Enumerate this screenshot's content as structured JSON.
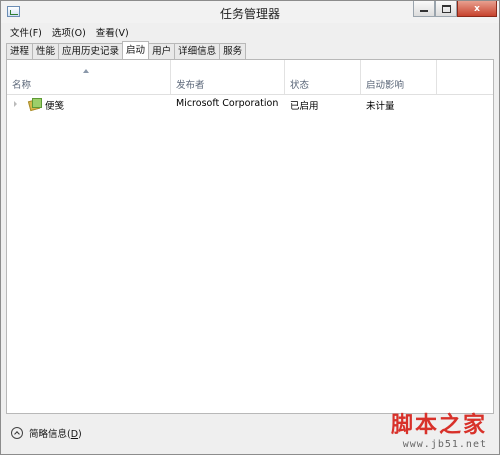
{
  "window": {
    "title": "任务管理器",
    "controls": {
      "close_label": "x"
    }
  },
  "menubar": {
    "items": [
      "文件(F)",
      "选项(O)",
      "查看(V)"
    ]
  },
  "tabs": [
    "进程",
    "性能",
    "应用历史记录",
    "启动",
    "用户",
    "详细信息",
    "服务"
  ],
  "active_tab": "启动",
  "table": {
    "columns": [
      "名称",
      "发布者",
      "状态",
      "启动影响"
    ],
    "rows": [
      {
        "name": "便笺",
        "publisher": "Microsoft Corporation",
        "status": "已启用",
        "impact": "未计量"
      }
    ]
  },
  "footer": {
    "toggle_label": "简略信息(",
    "toggle_key": "D",
    "toggle_end": ")"
  },
  "watermark": {
    "main": "脚本之家",
    "sub": "www.jb51.net"
  },
  "colors": {
    "header_text": "#5a6678",
    "watermark_red": "#d8312a"
  }
}
